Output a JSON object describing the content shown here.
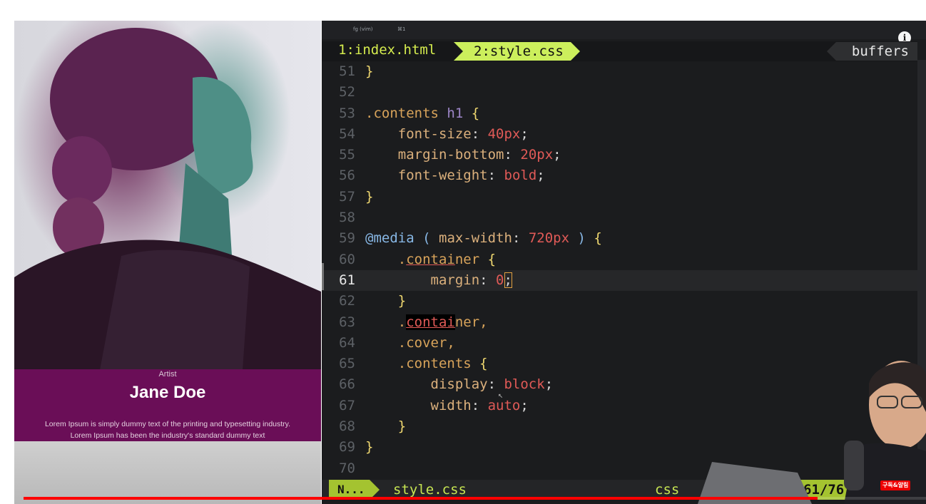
{
  "preview": {
    "role": "Artist",
    "name": "Jane Doe",
    "bio_line1": "Lorem Ipsum is simply dummy text of the printing and typesetting industry.",
    "bio_line2": "Lorem Ipsum has been the industry's standard dummy text"
  },
  "window": {
    "title": "fg (vim)",
    "shortcut": "⌘1"
  },
  "tabs": {
    "inactive": "1:index.html",
    "active": "2:style.css",
    "buffers": "buffers"
  },
  "code": {
    "current_line": 61,
    "lines": [
      {
        "n": "51"
      },
      {
        "n": "52"
      },
      {
        "n": "53"
      },
      {
        "n": "54"
      },
      {
        "n": "55"
      },
      {
        "n": "56"
      },
      {
        "n": "57"
      },
      {
        "n": "58"
      },
      {
        "n": "59"
      },
      {
        "n": "60"
      },
      {
        "n": "61"
      },
      {
        "n": "62"
      },
      {
        "n": "63"
      },
      {
        "n": "64"
      },
      {
        "n": "65"
      },
      {
        "n": "66"
      },
      {
        "n": "67"
      },
      {
        "n": "68"
      },
      {
        "n": "69"
      },
      {
        "n": "70"
      }
    ],
    "tokens": {
      "l51": "}",
      "l53_sel": ".contents",
      "l53_tag": "h1",
      "l53_brace": "{",
      "l54_prop": "font-size",
      "l54_val": "40px",
      "l55_prop": "margin-bottom",
      "l55_val": "20px",
      "l56_prop": "font-weight",
      "l56_val": "bold",
      "l57": "}",
      "l59_at": "@media",
      "l59_open": "(",
      "l59_prop": "max-width",
      "l59_val": "720px",
      "l59_close": ")",
      "l59_brace": "{",
      "l60_dot": ".",
      "l60_match": "contai",
      "l60_rest": "ner",
      "l60_brace": "{",
      "l61_prop": "margin",
      "l61_val": "0",
      "l61_semi": ";",
      "l62": "}",
      "l63_dot": ".",
      "l63_match": "contai",
      "l63_rest": "ner,",
      "l64": ".cover,",
      "l65_sel": ".contents",
      "l65_brace": "{",
      "l66_prop": "display",
      "l66_val": "block",
      "l67_prop": "width",
      "l67_val": "auto",
      "l68": "}",
      "l69": "}"
    }
  },
  "statusline": {
    "mode": "N...",
    "filename": "style.css",
    "filetype": "css",
    "position": "61/76"
  },
  "video": {
    "progress": 0.88,
    "subscribe_badge": "구독&알림"
  },
  "colors": {
    "accent": "#ccef5c",
    "profile_band": "#6a0e57",
    "progress": "#ff0000"
  }
}
